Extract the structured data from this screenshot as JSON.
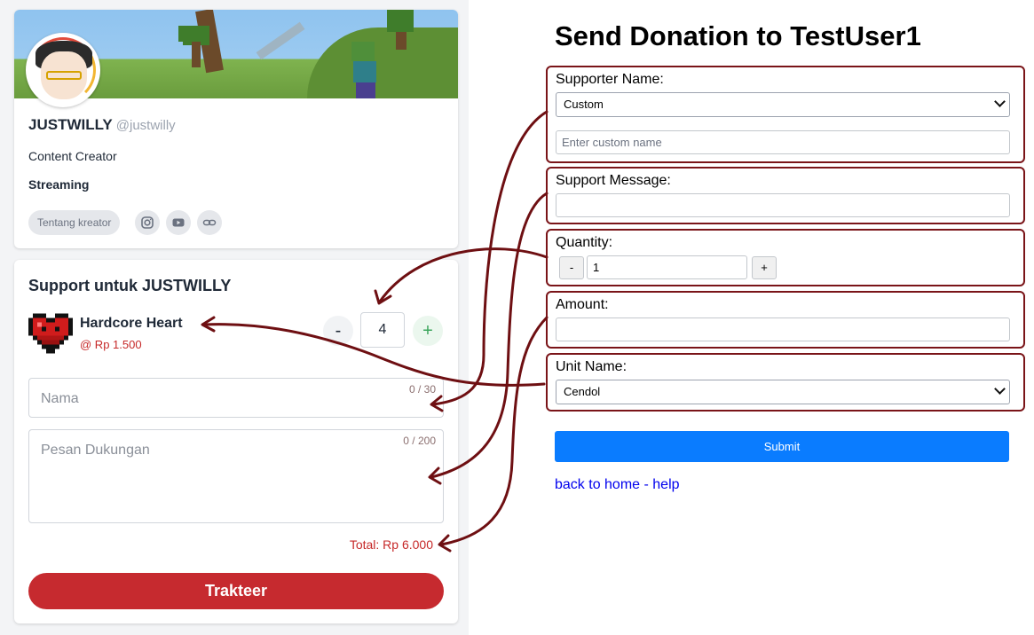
{
  "profile": {
    "name": "JUSTWILLY",
    "handle": "@justwilly",
    "role": "Content Creator",
    "category": "Streaming",
    "about_label": "Tentang kreator",
    "social_icons": [
      "instagram-icon",
      "youtube-icon",
      "link-icon"
    ]
  },
  "support": {
    "title": "Support untuk JUSTWILLY",
    "item_name": "Hardcore Heart",
    "item_price": "@ Rp 1.500",
    "qty_minus": "-",
    "qty_value": "4",
    "qty_plus": "+",
    "name_placeholder": "Nama",
    "name_counter": "0 / 30",
    "message_placeholder": "Pesan Dukungan",
    "message_counter": "0 / 200",
    "total": "Total: Rp 6.000",
    "button_label": "Trakteer"
  },
  "form": {
    "title": "Send Donation to TestUser1",
    "supporter_label": "Supporter Name:",
    "supporter_select": "Custom",
    "custom_name_placeholder": "Enter custom name",
    "message_label": "Support Message:",
    "message_value": "",
    "quantity_label": "Quantity:",
    "qty_minus": "-",
    "qty_value": "1",
    "qty_plus": "+",
    "amount_label": "Amount:",
    "amount_value": "",
    "unit_label": "Unit Name:",
    "unit_select": "Cendol",
    "submit_label": "Submit",
    "links": "back to home - help"
  },
  "colors": {
    "accent_red": "#c62a2f",
    "arrow": "#6e0f12",
    "submit_blue": "#0a7cff"
  }
}
